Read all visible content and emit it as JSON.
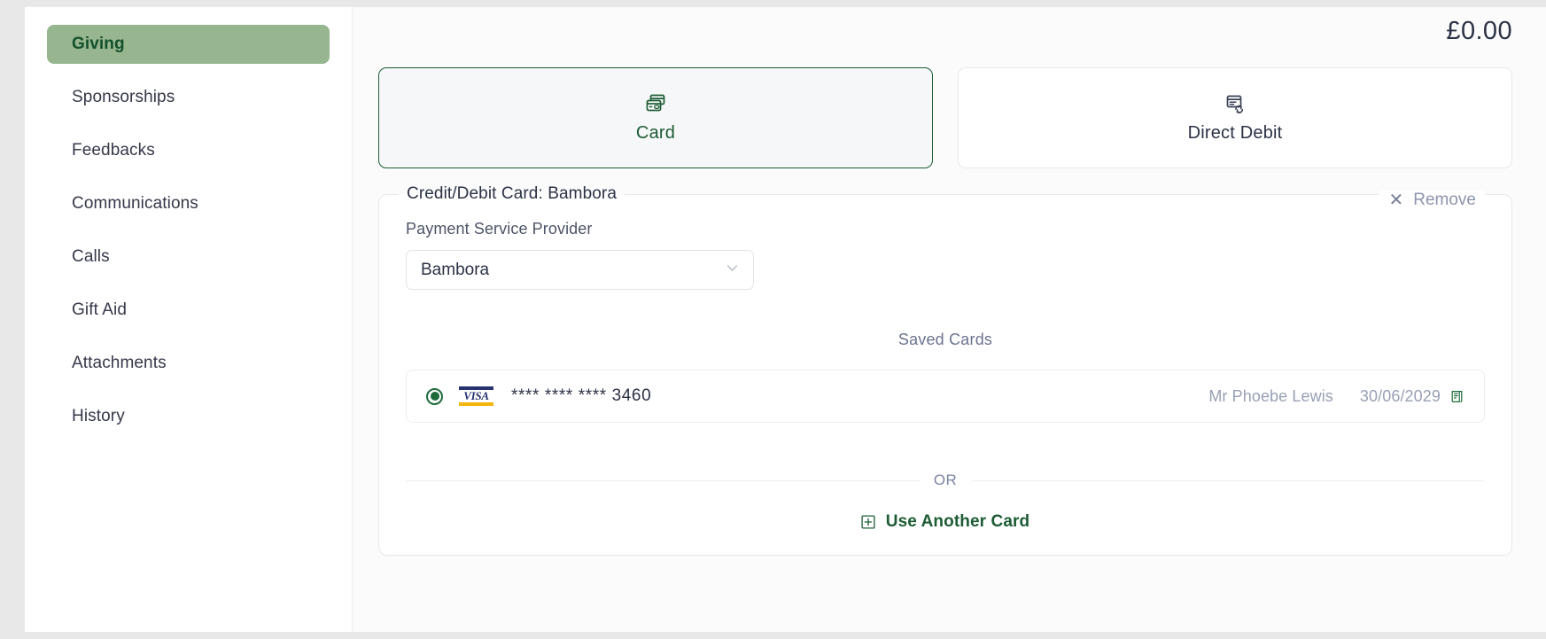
{
  "sidebar": {
    "items": [
      {
        "label": "Giving",
        "active": true
      },
      {
        "label": "Sponsorships",
        "active": false
      },
      {
        "label": "Feedbacks",
        "active": false
      },
      {
        "label": "Communications",
        "active": false
      },
      {
        "label": "Calls",
        "active": false
      },
      {
        "label": "Gift Aid",
        "active": false
      },
      {
        "label": "Attachments",
        "active": false
      },
      {
        "label": "History",
        "active": false
      }
    ]
  },
  "header": {
    "total_amount": "£0.00"
  },
  "payment_methods": [
    {
      "label": "Card",
      "icon": "stacked-cards-icon",
      "selected": true
    },
    {
      "label": "Direct Debit",
      "icon": "recurring-invoice-icon",
      "selected": false
    }
  ],
  "panel": {
    "legend": "Credit/Debit Card: Bambora",
    "remove_label": "Remove",
    "remove_icon": "close-icon",
    "provider_label": "Payment Service Provider",
    "provider_value": "Bambora",
    "provider_options": [
      "Bambora"
    ],
    "saved_cards_title": "Saved Cards",
    "saved_cards": [
      {
        "selected": true,
        "brand": "visa",
        "brand_text": "VISA",
        "masked_number": "**** **** **** 3460",
        "holder": "Mr Phoebe Lewis",
        "expiry": "30/06/2029",
        "doc_icon": "document-icon"
      }
    ],
    "or_text": "OR",
    "use_another_label": "Use Another Card",
    "use_another_icon": "plus-square-icon"
  },
  "colors": {
    "accent_green": "#1d5c34",
    "sidebar_active_bg": "#97b68f",
    "sidebar_active_text": "#13502c",
    "text_primary": "#2b3245",
    "text_muted": "#98a0b4",
    "border": "#e7e8ec",
    "visa_blue": "#26336e",
    "visa_yellow": "#f4b50a"
  }
}
